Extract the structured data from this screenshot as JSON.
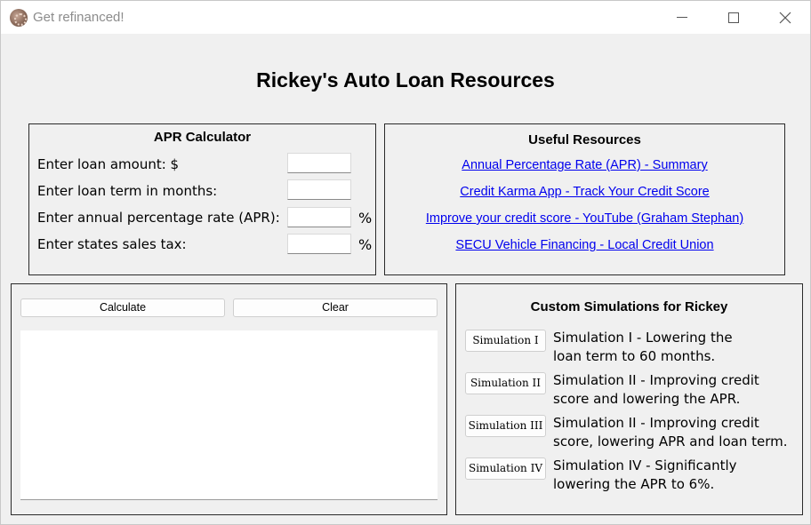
{
  "window": {
    "title": "Get refinanced!"
  },
  "app_title": "Rickey's Auto Loan Resources",
  "calculator": {
    "heading": "APR Calculator",
    "fields": [
      {
        "label": "Enter loan amount: $",
        "value": "",
        "unit": ""
      },
      {
        "label": "Enter loan term in months:",
        "value": "",
        "unit": ""
      },
      {
        "label": "Enter annual percentage rate (APR):",
        "value": "",
        "unit": "%"
      },
      {
        "label": "Enter states sales tax:",
        "value": "",
        "unit": "%"
      }
    ]
  },
  "resources": {
    "heading": "Useful Resources",
    "links": [
      "Annual Percentage Rate (APR) - Summary",
      "Credit Karma App - Track Your Credit Score",
      "Improve your credit score - YouTube (Graham Stephan)",
      "SECU Vehicle Financing - Local Credit Union"
    ]
  },
  "output": {
    "calculate_label": "Calculate",
    "clear_label": "Clear",
    "text": ""
  },
  "simulations": {
    "heading": "Custom Simulations for Rickey",
    "items": [
      {
        "button": "Simulation I",
        "line1": "Simulation I - Lowering the",
        "line2": "loan term to 60 months."
      },
      {
        "button": "Simulation II",
        "line1": "Simulation II - Improving credit",
        "line2": "score and lowering the APR."
      },
      {
        "button": "Simulation III",
        "line1": "Simulation II - Improving credit",
        "line2": "score, lowering APR and loan term."
      },
      {
        "button": "Simulation IV",
        "line1": "Simulation IV - Significantly",
        "line2": "lowering the APR to 6%."
      }
    ]
  },
  "colors": {
    "window_bg": "#f0f0f0",
    "link": "#0000ee",
    "border": "#2a2a2a"
  },
  "icons": {
    "app": "app-icon",
    "minimize": "minimize-icon",
    "maximize": "maximize-icon",
    "close": "close-icon"
  }
}
